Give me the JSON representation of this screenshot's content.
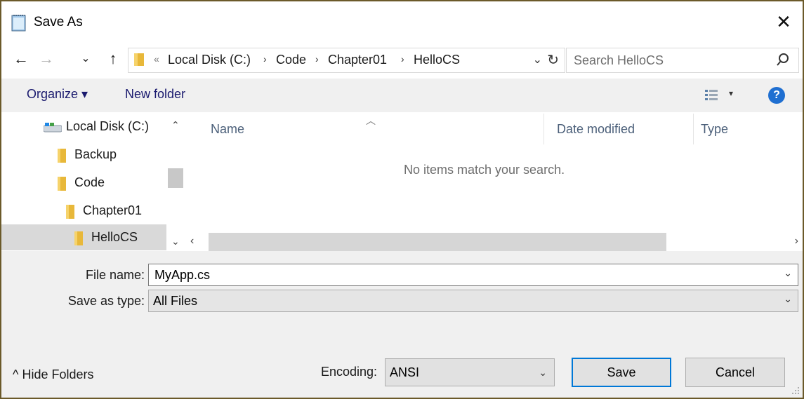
{
  "window": {
    "title": "Save As",
    "close_glyph": "✕"
  },
  "nav": {
    "back_glyph": "←",
    "forward_glyph": "→",
    "recent_glyph": "⌄",
    "up_glyph": "↑",
    "path_overflow": "«",
    "path": [
      "Local Disk (C:)",
      "Code",
      "Chapter01",
      "HelloCS"
    ],
    "path_separator": "›",
    "dropdown_glyph": "⌄",
    "refresh_glyph": "↻",
    "search_placeholder": "Search HelloCS"
  },
  "toolbar": {
    "organize": "Organize ▾",
    "new_folder": "New folder",
    "view_dd": "▾",
    "help": "?"
  },
  "tree": [
    {
      "label": "Local Disk (C:)",
      "icon": "drive-icon"
    },
    {
      "label": "Backup",
      "icon": "folder-icon"
    },
    {
      "label": "Code",
      "icon": "folder-icon"
    },
    {
      "label": "Chapter01",
      "icon": "folder-icon"
    },
    {
      "label": "HelloCS",
      "icon": "folder-icon",
      "selected": true
    }
  ],
  "list": {
    "columns": [
      "Name",
      "Date modified",
      "Type"
    ],
    "sort_glyph": "︿",
    "empty_message": "No items match your search."
  },
  "scroll": {
    "up": "⌃",
    "down": "⌄",
    "left": "‹",
    "right": "›"
  },
  "form": {
    "file_name_label": "File name:",
    "file_name_value": "MyApp.cs",
    "save_type_label": "Save as type:",
    "save_type_value": "All Files",
    "dd_glyph": "⌄"
  },
  "footer": {
    "hide_folders": "^ Hide Folders",
    "encoding_label": "Encoding:",
    "encoding_value": "ANSI",
    "save": "Save",
    "cancel": "Cancel"
  },
  "colors": {
    "accent": "#0078d7",
    "toolbar_bg": "#f0f0f0",
    "selection": "#d9d9d9",
    "folder": "#e8b83a"
  }
}
